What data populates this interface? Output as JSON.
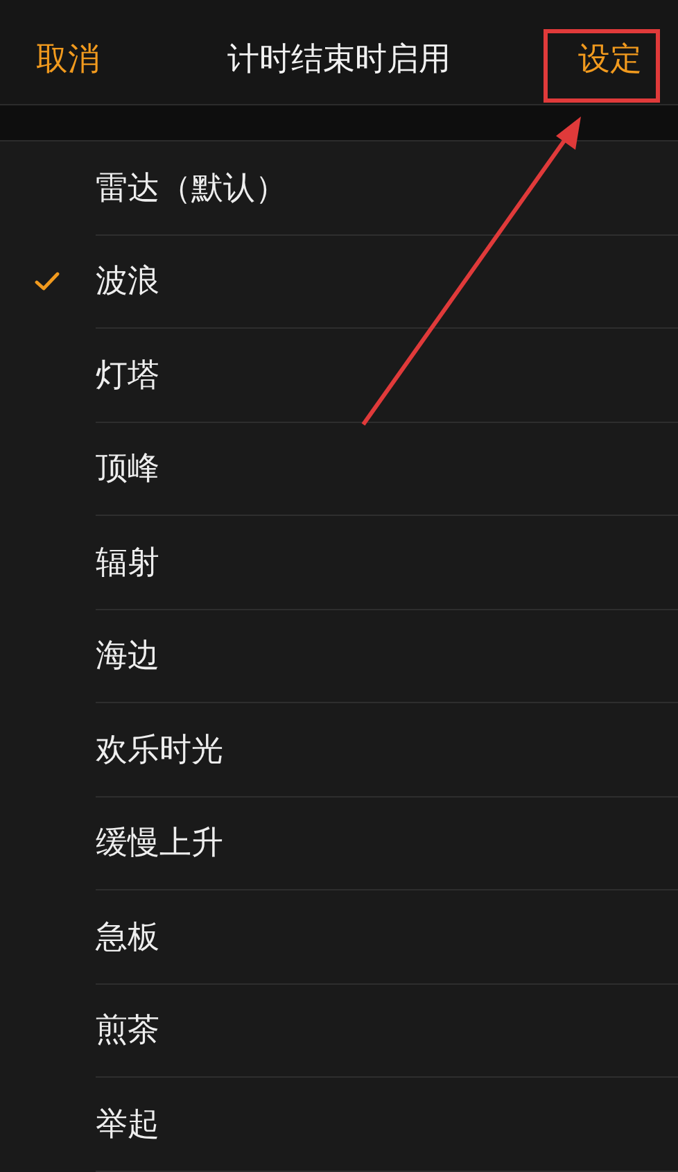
{
  "nav_bar": {
    "cancel": "取消",
    "title": "计时结束时启用",
    "confirm": "设定"
  },
  "sounds": [
    {
      "label": "雷达（默认）",
      "selected": false
    },
    {
      "label": "波浪",
      "selected": true
    },
    {
      "label": "灯塔",
      "selected": false
    },
    {
      "label": "顶峰",
      "selected": false
    },
    {
      "label": "辐射",
      "selected": false
    },
    {
      "label": "海边",
      "selected": false
    },
    {
      "label": "欢乐时光",
      "selected": false
    },
    {
      "label": "缓慢上升",
      "selected": false
    },
    {
      "label": "急板",
      "selected": false
    },
    {
      "label": "煎茶",
      "selected": false
    },
    {
      "label": "举起",
      "selected": false
    }
  ]
}
